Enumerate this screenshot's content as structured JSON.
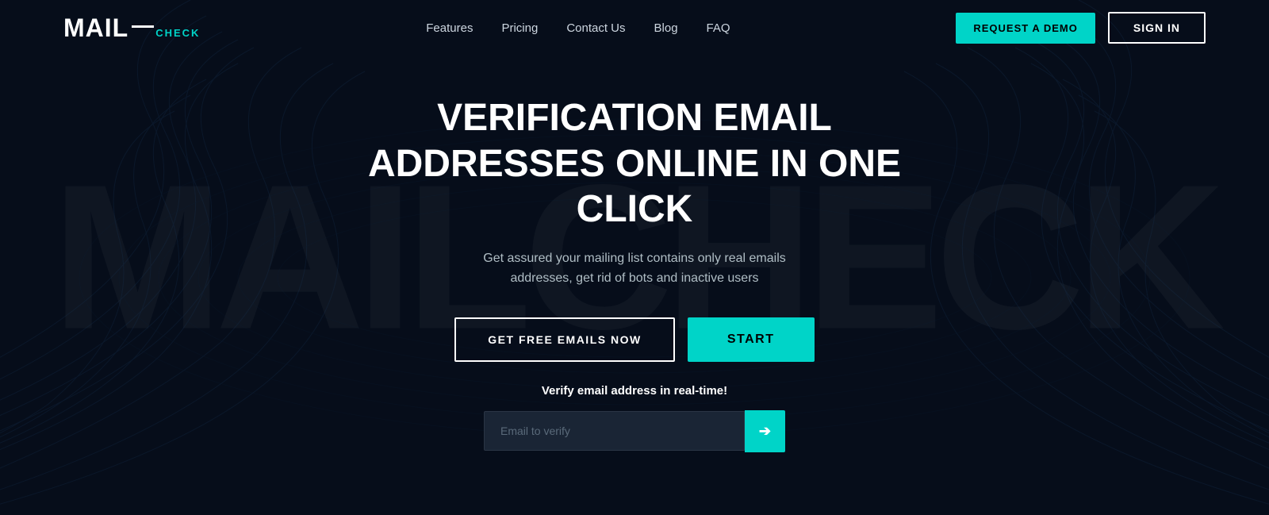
{
  "logo": {
    "mail": "MAIL",
    "check": "CHECK",
    "watermark": "MAILCHECK"
  },
  "nav": {
    "links": [
      {
        "label": "Features",
        "id": "features"
      },
      {
        "label": "Pricing",
        "id": "pricing"
      },
      {
        "label": "Contact Us",
        "id": "contact"
      },
      {
        "label": "Blog",
        "id": "blog"
      },
      {
        "label": "FAQ",
        "id": "faq"
      }
    ],
    "demo_button": "REQUEST A DEMO",
    "signin_button": "SIGN IN"
  },
  "hero": {
    "title": "VERIFICATION EMAIL ADDRESSES ONLINE IN ONE CLICK",
    "subtitle": "Get assured your mailing list contains only real emails addresses, get rid of bots and inactive users",
    "btn_free": "GET FREE EMAILS NOW",
    "btn_start": "START",
    "realtime_label": "Verify email address in real-time!",
    "email_placeholder": "Email to verify"
  },
  "colors": {
    "accent": "#00d4c8",
    "bg": "#060d1a",
    "nav_link": "#cdd6e0"
  }
}
